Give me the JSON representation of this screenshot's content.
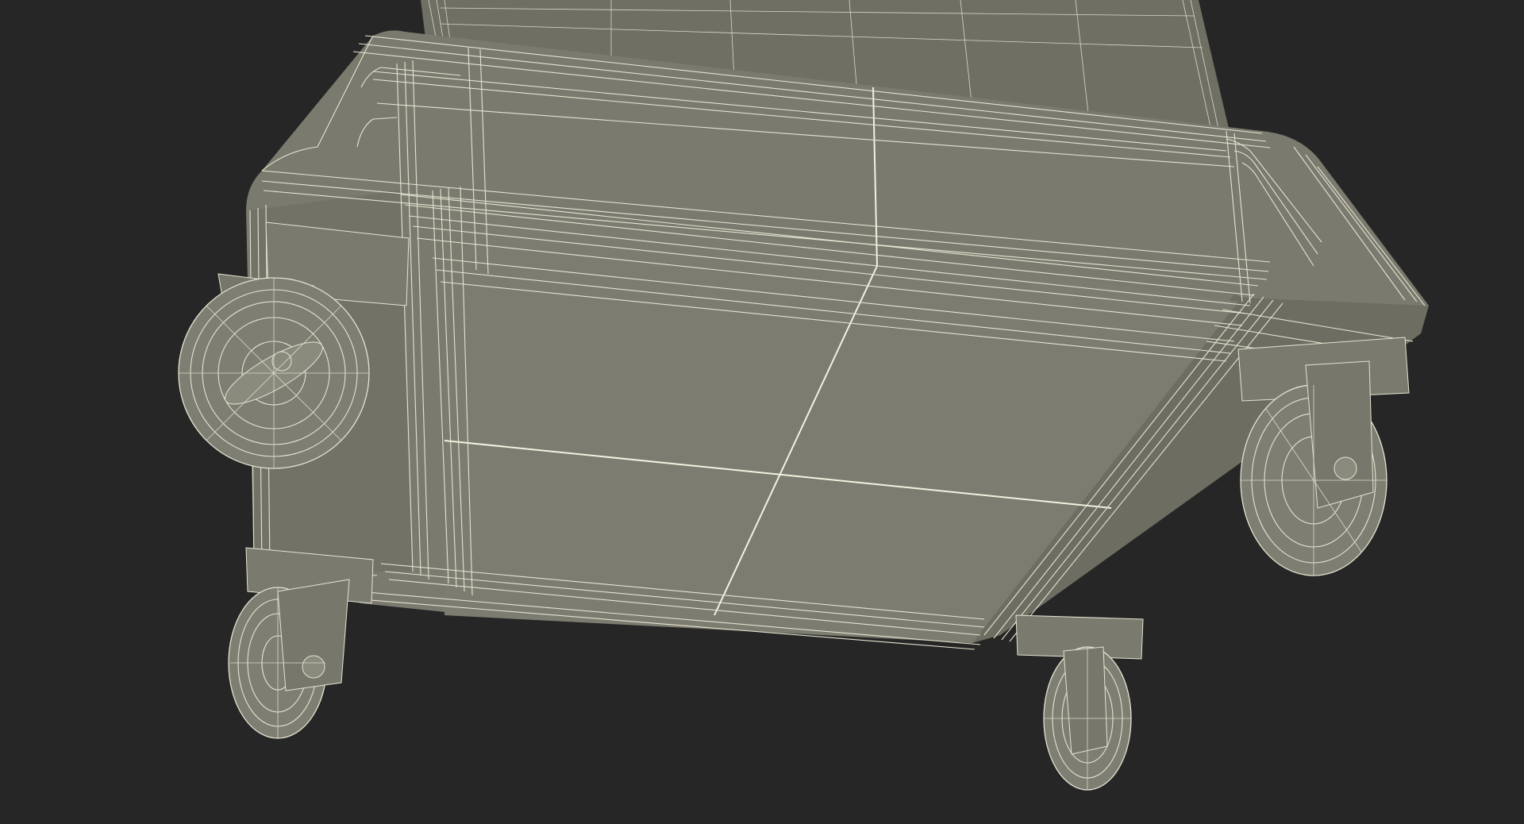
{
  "scene": {
    "subject": "tool-cart-wireframe-underside",
    "background_color": "#262626",
    "surface_color": "#7a7a6e",
    "surface_shadow_color": "#66665b",
    "wire_color": "#e6e3d0"
  }
}
